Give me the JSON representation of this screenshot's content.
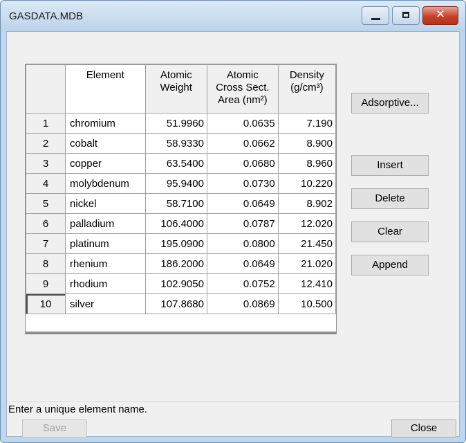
{
  "window": {
    "title": "GASDATA.MDB",
    "close_glyph": "✕"
  },
  "grid": {
    "headers": {
      "element": "Element",
      "atomic_weight_l1": "Atomic",
      "atomic_weight_l2": "Weight",
      "cross_l1": "Atomic",
      "cross_l2": "Cross Sect.",
      "cross_l3": "Area (nm²)",
      "density_l1": "Density",
      "density_l2": "(g/cm³)"
    },
    "rows": [
      {
        "n": "1",
        "name": "chromium",
        "weight": "51.9960",
        "cross": "0.0635",
        "density": "7.190"
      },
      {
        "n": "2",
        "name": "cobalt",
        "weight": "58.9330",
        "cross": "0.0662",
        "density": "8.900"
      },
      {
        "n": "3",
        "name": "copper",
        "weight": "63.5400",
        "cross": "0.0680",
        "density": "8.960"
      },
      {
        "n": "4",
        "name": "molybdenum",
        "weight": "95.9400",
        "cross": "0.0730",
        "density": "10.220"
      },
      {
        "n": "5",
        "name": "nickel",
        "weight": "58.7100",
        "cross": "0.0649",
        "density": "8.902"
      },
      {
        "n": "6",
        "name": "palladium",
        "weight": "106.4000",
        "cross": "0.0787",
        "density": "12.020"
      },
      {
        "n": "7",
        "name": "platinum",
        "weight": "195.0900",
        "cross": "0.0800",
        "density": "21.450"
      },
      {
        "n": "8",
        "name": "rhenium",
        "weight": "186.2000",
        "cross": "0.0649",
        "density": "21.020"
      },
      {
        "n": "9",
        "name": "rhodium",
        "weight": "102.9050",
        "cross": "0.0752",
        "density": "12.410"
      },
      {
        "n": "10",
        "name": "silver",
        "weight": "107.8680",
        "cross": "0.0869",
        "density": "10.500"
      }
    ]
  },
  "buttons": {
    "adsorptive": "Adsorptive...",
    "insert": "Insert",
    "delete": "Delete",
    "clear": "Clear",
    "append": "Append",
    "save": "Save",
    "close": "Close"
  },
  "status": {
    "message": "Enter a unique element name."
  }
}
